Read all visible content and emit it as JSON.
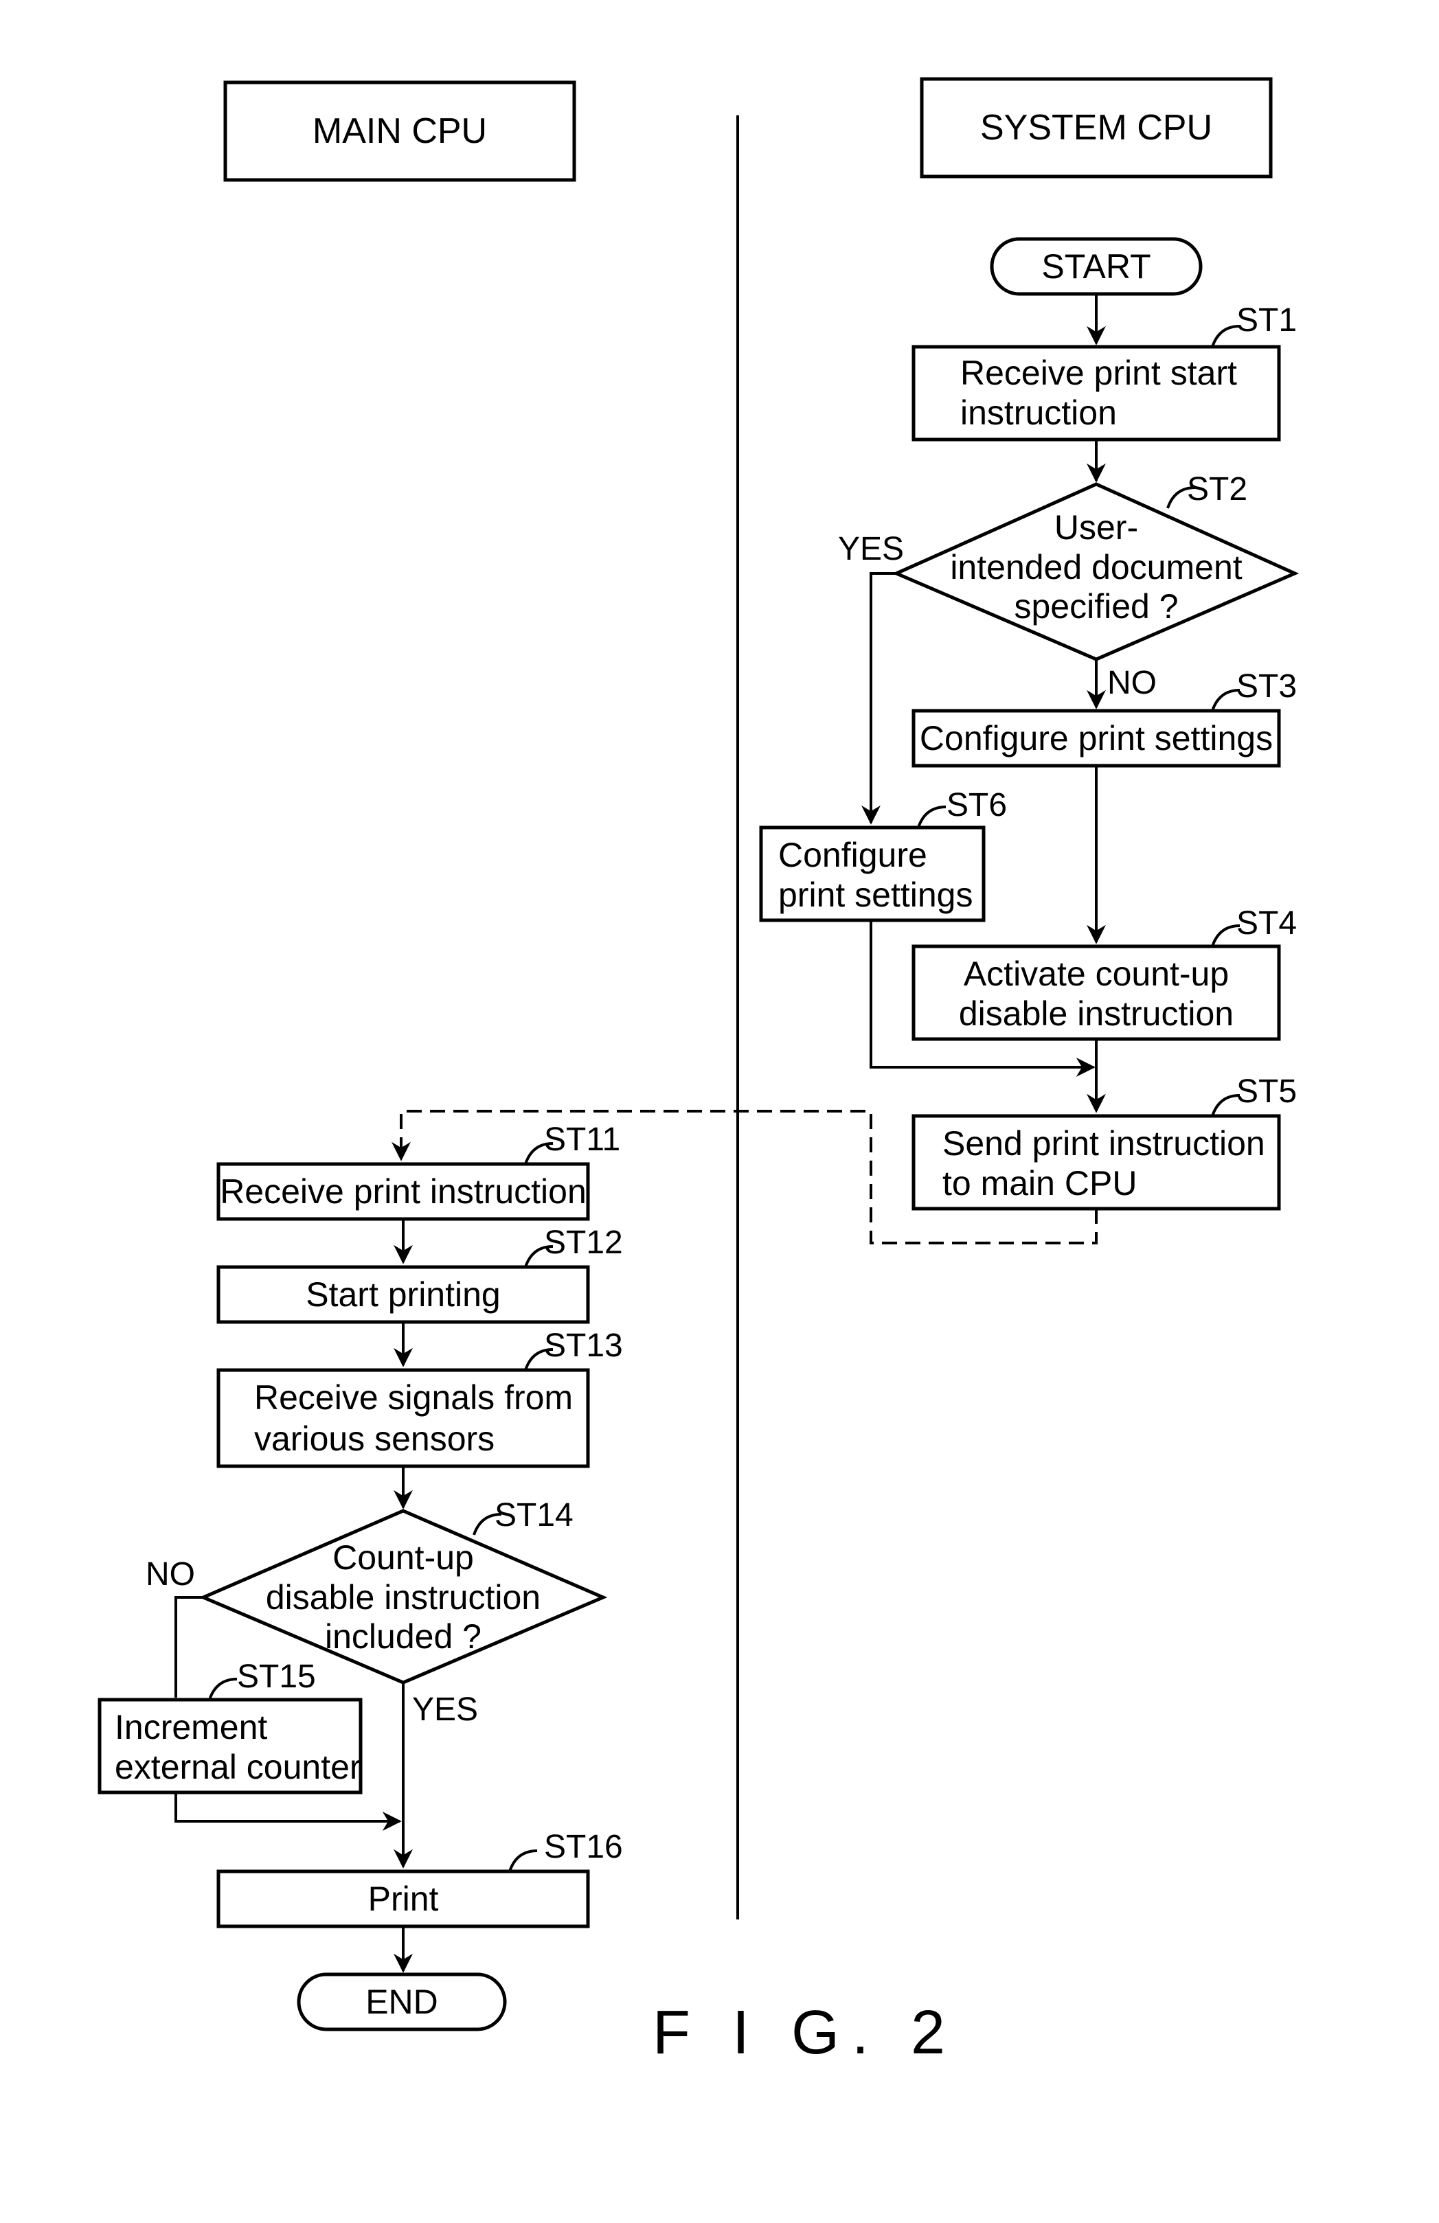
{
  "figure": {
    "caption": "F I G. 2",
    "lanes": {
      "left": "MAIN CPU",
      "right": "SYSTEM CPU"
    },
    "system_cpu": {
      "start": "START",
      "steps": [
        {
          "id": "ST1",
          "lines": [
            "Receive print start",
            "instruction"
          ]
        },
        {
          "id": "ST2",
          "type": "decision",
          "lines": [
            "User-",
            "intended document",
            "specified ?"
          ],
          "yes": "YES",
          "no": "NO"
        },
        {
          "id": "ST3",
          "lines": [
            "Configure print settings"
          ]
        },
        {
          "id": "ST6",
          "lines": [
            "Configure",
            "print settings"
          ]
        },
        {
          "id": "ST4",
          "lines": [
            "Activate count-up",
            "disable instruction"
          ]
        },
        {
          "id": "ST5",
          "lines": [
            "Send print instruction",
            "to main CPU"
          ]
        }
      ]
    },
    "main_cpu": {
      "steps": [
        {
          "id": "ST11",
          "lines": [
            "Receive print instruction"
          ]
        },
        {
          "id": "ST12",
          "lines": [
            "Start printing"
          ]
        },
        {
          "id": "ST13",
          "lines": [
            "Receive signals from",
            "various sensors"
          ]
        },
        {
          "id": "ST14",
          "type": "decision",
          "lines": [
            "Count-up",
            "disable instruction",
            "included ?"
          ],
          "yes": "YES",
          "no": "NO"
        },
        {
          "id": "ST15",
          "lines": [
            "Increment",
            "external counter"
          ]
        },
        {
          "id": "ST16",
          "lines": [
            "Print"
          ]
        }
      ],
      "end": "END"
    }
  }
}
